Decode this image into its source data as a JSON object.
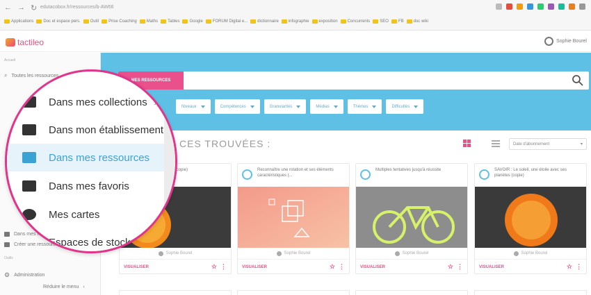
{
  "browser": {
    "url": "edutacobox.fr/ressources/b-AW66",
    "bookmarks": [
      "Applications",
      "Doc et espace pers.",
      "Outil",
      "Prise Coaching",
      "Maths",
      "Tables",
      "Google",
      "FORUM Digital e...",
      "dictionnaire",
      "infographie",
      "exposition",
      "Concurrents",
      "SEO",
      "FB",
      "doc wiki"
    ]
  },
  "app": {
    "logo": "tactileo",
    "user_name": "Sophie Bourel"
  },
  "sidebar": {
    "section_top": "Accueil",
    "search_item": "Toutes les ressources",
    "items": [
      "Dans mes collections",
      "Dans mes ressources",
      "Créer une ressource"
    ],
    "section_bottom": "Outils",
    "admin": "Administration",
    "collapse": "Réduire le menu"
  },
  "search": {
    "tab_label": "MES RESSOURCES",
    "placeholder": ""
  },
  "filters": [
    "Niveaux",
    "Compétences",
    "Granularités",
    "Médias",
    "Thèmes",
    "Difficultés"
  ],
  "results": {
    "title": "CES TROUVÉES :",
    "sort_label": "Date d'abonnement"
  },
  "cards": [
    {
      "title": "Le système solaire (copie)",
      "author": "Sophie Bourel",
      "action": "VISUALISER"
    },
    {
      "title": "Reconnaître une rotation et ses éléments caractéristiques (...",
      "author": "Sophie Bourel",
      "action": "VISUALISER"
    },
    {
      "title": "Multiples tentatives jusqu'à réussite",
      "author": "Sophie Bourel",
      "action": "VISUALISER"
    },
    {
      "title": "SAVOIR : Le soleil, une étoile avec ses planètes (copie)",
      "author": "Sophie Bourel",
      "action": "VISUALISER"
    }
  ],
  "magnifier": {
    "items": [
      {
        "label": "Dans mes collections",
        "icon": "collection-icon",
        "active": false
      },
      {
        "label": "Dans mon établissement",
        "icon": "school-icon",
        "active": false
      },
      {
        "label": "Dans mes ressources",
        "icon": "folder-icon",
        "active": true
      },
      {
        "label": "Dans mes favoris",
        "icon": "favorites-icon",
        "active": false
      },
      {
        "label": "Mes cartes",
        "icon": "map-pin-icon",
        "active": false
      },
      {
        "label": "Espaces de stockage",
        "icon": "storage-icon",
        "active": false
      }
    ]
  },
  "colors": {
    "accent_pink": "#e9508c",
    "banner_blue": "#5fc0e6",
    "active_blue": "#3aa3d4"
  }
}
